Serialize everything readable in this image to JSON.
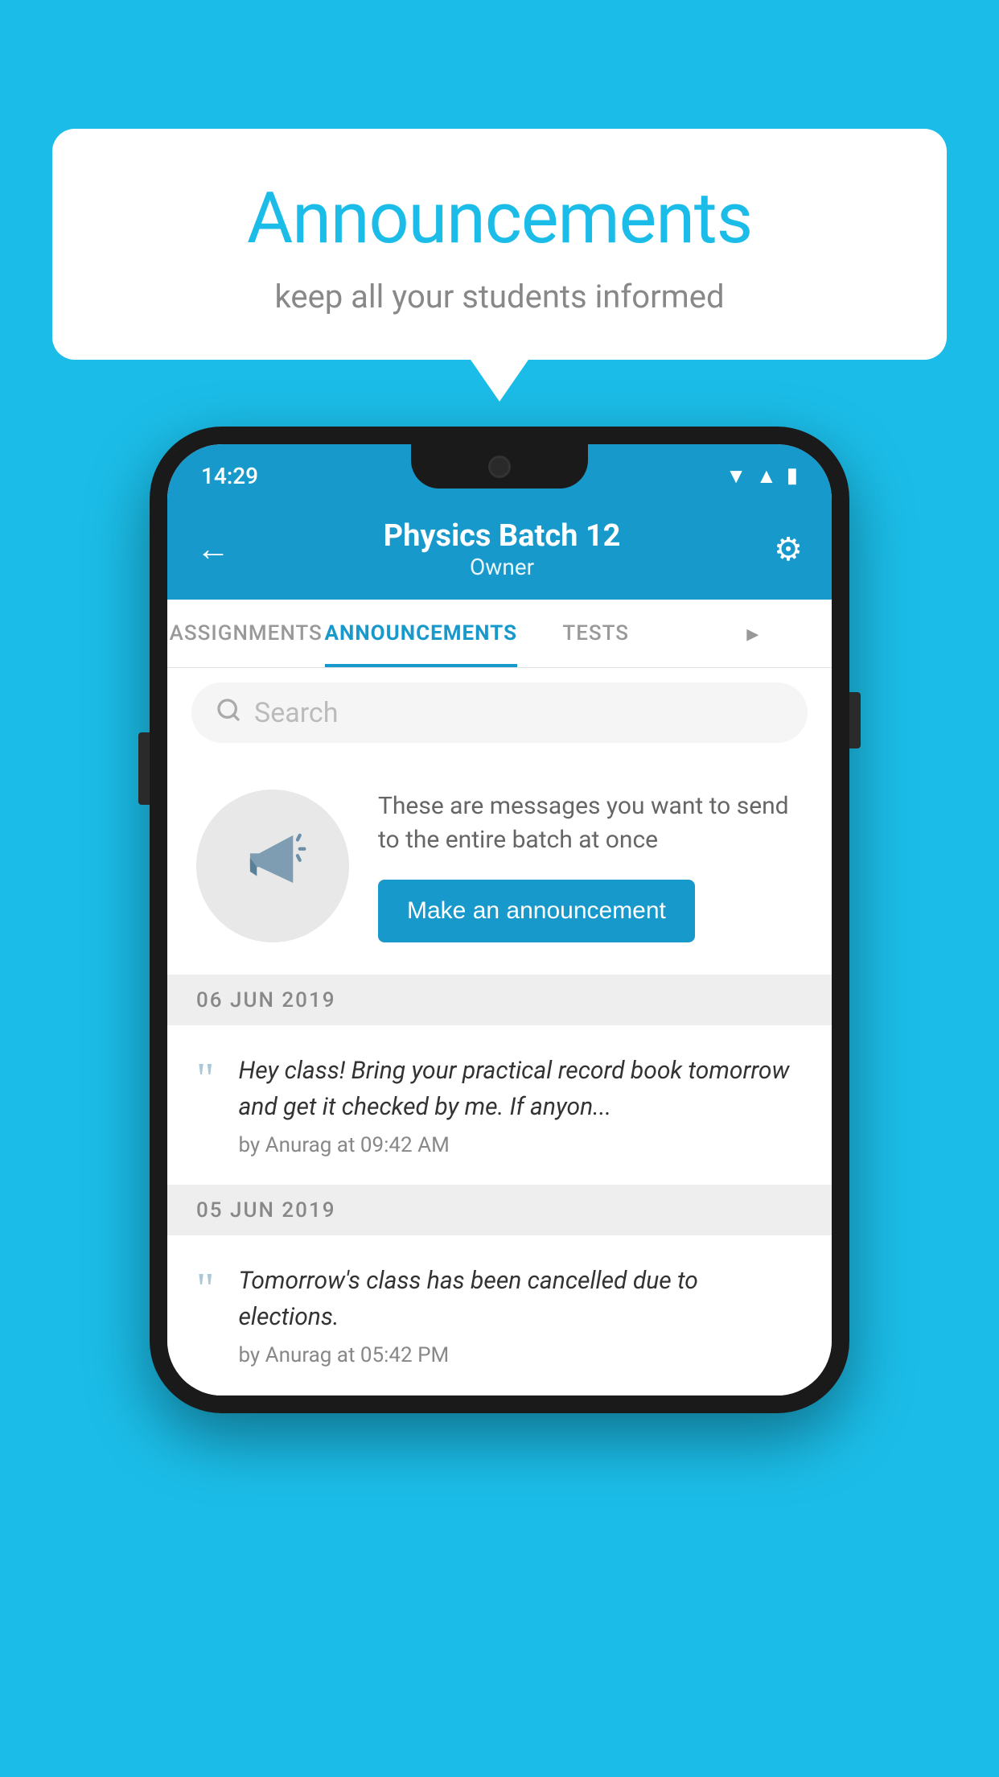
{
  "background_color": "#1BBDE8",
  "speech_bubble": {
    "title": "Announcements",
    "subtitle": "keep all your students informed"
  },
  "phone": {
    "status_bar": {
      "time": "14:29",
      "icons": [
        "wifi",
        "signal",
        "battery"
      ]
    },
    "header": {
      "title": "Physics Batch 12",
      "subtitle": "Owner",
      "back_label": "←",
      "gear_label": "⚙"
    },
    "tabs": [
      {
        "label": "ASSIGNMENTS",
        "active": false
      },
      {
        "label": "ANNOUNCEMENTS",
        "active": true
      },
      {
        "label": "TESTS",
        "active": false
      },
      {
        "label": "▸",
        "active": false
      }
    ],
    "search": {
      "placeholder": "Search"
    },
    "promo": {
      "description": "These are messages you want to send to the entire batch at once",
      "button_label": "Make an announcement"
    },
    "announcements": [
      {
        "date": "06  JUN  2019",
        "text": "Hey class! Bring your practical record book tomorrow and get it checked by me. If anyon...",
        "meta": "by Anurag at 09:42 AM"
      },
      {
        "date": "05  JUN  2019",
        "text": "Tomorrow's class has been cancelled due to elections.",
        "meta": "by Anurag at 05:42 PM"
      }
    ]
  }
}
